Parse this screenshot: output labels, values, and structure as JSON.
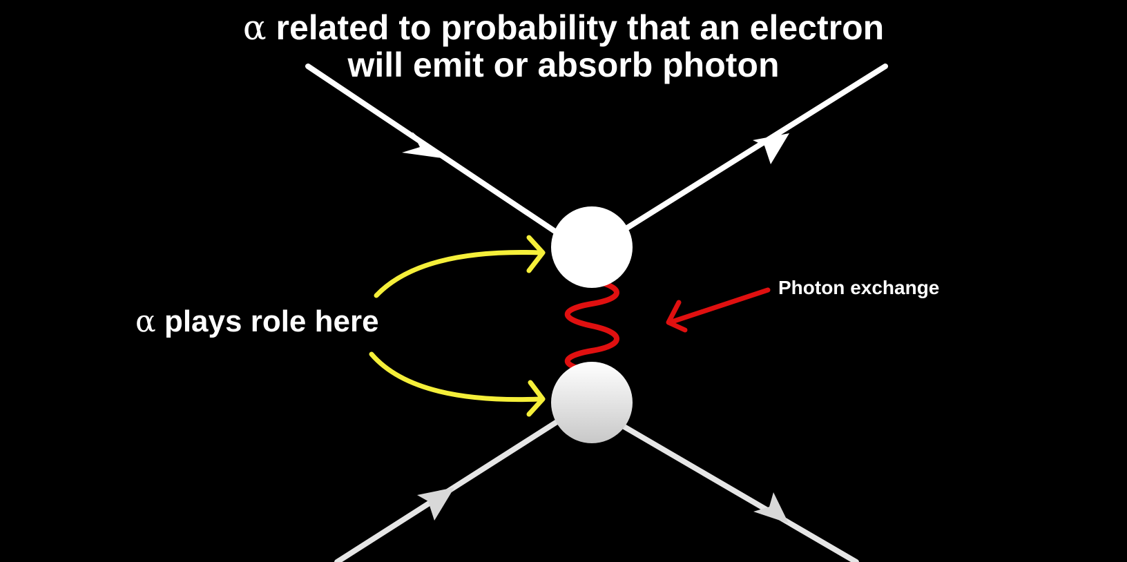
{
  "title": {
    "symbol": "α",
    "line1": "related to probability that an electron",
    "line2": "will emit or absorb photon"
  },
  "vertex_label": {
    "symbol": "α",
    "text": "plays role here"
  },
  "photon_label": "Photon exchange",
  "colors": {
    "background": "#000000",
    "electron_line": "#ffffff",
    "vertex": "#ffffff",
    "photon": "#e01010",
    "annotation_arrow_yellow": "#f5ef3a",
    "annotation_arrow_red": "#e01010",
    "text": "#ffffff"
  },
  "icons": {
    "vertex": "filled-circle",
    "direction_marker": "triangle-arrowhead",
    "photon": "wavy-line"
  }
}
